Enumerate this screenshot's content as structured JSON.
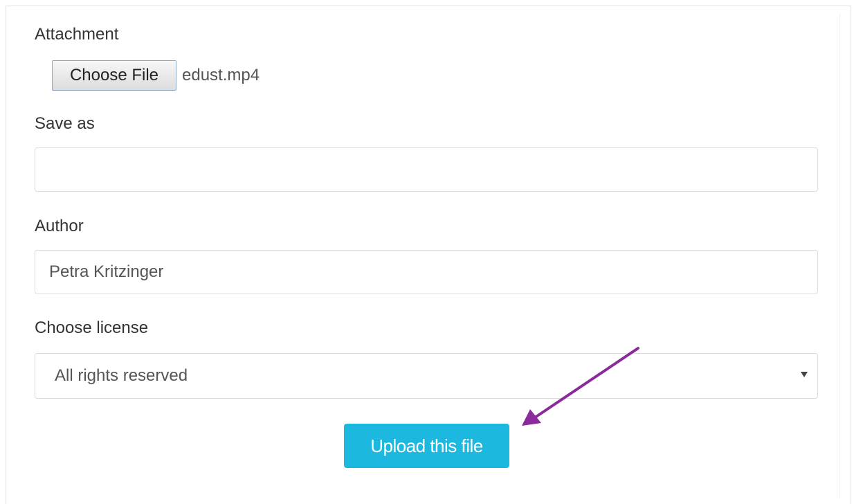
{
  "form": {
    "attachment_label": "Attachment",
    "choose_file_label": "Choose File",
    "selected_file_name": "edust.mp4",
    "save_as_label": "Save as",
    "save_as_value": "",
    "author_label": "Author",
    "author_value": "Petra Kritzinger",
    "license_label": "Choose license",
    "license_selected": "All rights reserved",
    "upload_button_label": "Upload this file"
  },
  "annotation": {
    "arrow_color": "#8b2a9b"
  },
  "colors": {
    "upload_button": "#1cb8df",
    "upload_button_text": "#ffffff"
  },
  "icons": {
    "select_caret": "caret-down-icon",
    "pointer_arrow": "annotation-arrow-icon"
  }
}
